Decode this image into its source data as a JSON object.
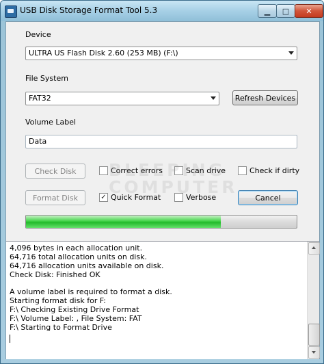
{
  "window": {
    "title": "USB Disk Storage Format Tool 5.3",
    "min_glyph": "▁",
    "max_glyph": "□",
    "close_glyph": "✕"
  },
  "device": {
    "label": "Device",
    "selected": "ULTRA US  Flash Disk  2.60 (253 MB) (F:\\)"
  },
  "file_system": {
    "label": "File System",
    "selected": "FAT32",
    "refresh_button": "Refresh Devices"
  },
  "volume_label": {
    "label": "Volume Label",
    "value": "Data"
  },
  "actions": {
    "check_disk": "Check Disk",
    "format_disk": "Format Disk",
    "cancel": "Cancel"
  },
  "options": {
    "correct_errors": {
      "label": "Correct errors",
      "checked": false
    },
    "scan_drive": {
      "label": "Scan drive",
      "checked": false
    },
    "check_if_dirty": {
      "label": "Check if dirty",
      "checked": false
    },
    "quick_format": {
      "label": "Quick Format",
      "checked": true
    },
    "verbose": {
      "label": "Verbose",
      "checked": false
    }
  },
  "progress": {
    "fraction": 0.72
  },
  "watermark": {
    "line1": "BLEEPING",
    "line2": "COMPUTER"
  },
  "log": {
    "lines": [
      "4,096 bytes in each allocation unit.",
      "64,716 total allocation units on disk.",
      "64,716 allocation units available on disk.",
      "Check Disk: Finished OK",
      "",
      "A volume label is required to format a disk.",
      "Starting format disk for F:",
      "F:\\ Checking Existing Drive Format",
      "F:\\ Volume Label: , File System: FAT",
      "F:\\ Starting to Format Drive"
    ]
  },
  "colors": {
    "progress_green": "#22b92a",
    "title_bar": "#a7d0e6"
  }
}
